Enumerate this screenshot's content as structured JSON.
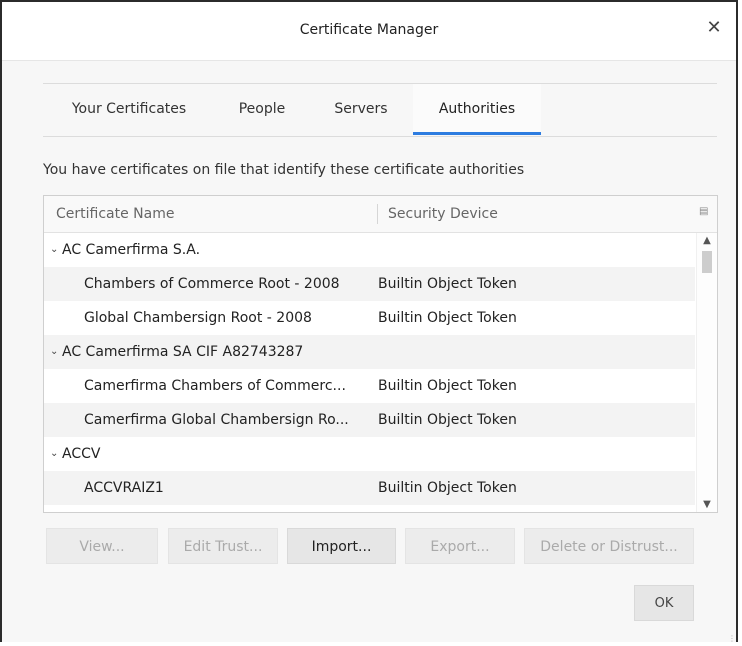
{
  "window": {
    "title": "Certificate Manager",
    "close_glyph": "✕"
  },
  "tabs": [
    {
      "label": "Your Certificates",
      "selected": false
    },
    {
      "label": "People",
      "selected": false
    },
    {
      "label": "Servers",
      "selected": false
    },
    {
      "label": "Authorities",
      "selected": true
    }
  ],
  "description": "You have certificates on file that identify these certificate authorities",
  "tree": {
    "columns": {
      "name": "Certificate Name",
      "device": "Security Device"
    },
    "rows": [
      {
        "type": "group",
        "label": "AC Camerfirma S.A."
      },
      {
        "type": "item",
        "name": "Chambers of Commerce Root - 2008",
        "device": "Builtin Object Token"
      },
      {
        "type": "item",
        "name": "Global Chambersign Root - 2008",
        "device": "Builtin Object Token"
      },
      {
        "type": "group",
        "label": "AC Camerfirma SA CIF A82743287"
      },
      {
        "type": "item",
        "name": "Camerfirma Chambers of Commerc...",
        "device": "Builtin Object Token"
      },
      {
        "type": "item",
        "name": "Camerfirma Global Chambersign Ro...",
        "device": "Builtin Object Token"
      },
      {
        "type": "group",
        "label": "ACCV"
      },
      {
        "type": "item",
        "name": "ACCVRAIZ1",
        "device": "Builtin Object Token"
      }
    ]
  },
  "buttons": {
    "view": {
      "label": "View...",
      "enabled": false
    },
    "edit_trust": {
      "label": "Edit Trust...",
      "enabled": false
    },
    "import": {
      "label": "Import...",
      "enabled": true
    },
    "export": {
      "label": "Export...",
      "enabled": false
    },
    "delete": {
      "label": "Delete or Distrust...",
      "enabled": false
    },
    "ok": {
      "label": "OK"
    }
  },
  "colors": {
    "accent": "#2d7ce0",
    "alt_row": "#f3f3f3",
    "disabled_text": "#aaaaaa"
  }
}
